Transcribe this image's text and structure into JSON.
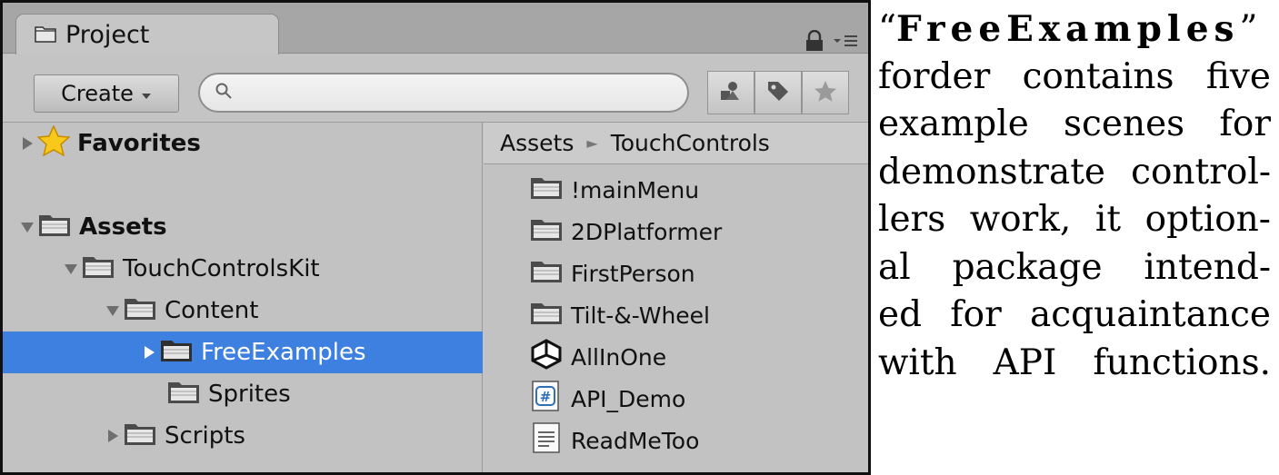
{
  "project_panel": {
    "tab": {
      "label": "Project",
      "icon": "folder-icon"
    },
    "toolbar": {
      "create_label": "Create",
      "search_value": "",
      "search_placeholder": "",
      "buttons": [
        "filter-by-type-icon",
        "filter-by-label-icon",
        "favorites-star-icon"
      ]
    },
    "tree": [
      {
        "label": "Favorites",
        "icon": "star-icon",
        "expanded": false,
        "bold": true
      },
      {
        "label": "Assets",
        "icon": "folder-icon",
        "expanded": true,
        "bold": true
      },
      {
        "label": "TouchControlsKit",
        "icon": "folder-icon",
        "expanded": true
      },
      {
        "label": "Content",
        "icon": "folder-icon",
        "expanded": true
      },
      {
        "label": "FreeExamples",
        "icon": "folder-icon",
        "expanded": false,
        "selected": true
      },
      {
        "label": "Sprites",
        "icon": "folder-icon"
      },
      {
        "label": "Scripts",
        "icon": "folder-icon",
        "expanded": false
      }
    ],
    "breadcrumb": [
      "Assets",
      "TouchControls"
    ],
    "items": [
      {
        "label": "!mainMenu",
        "icon": "folder-icon"
      },
      {
        "label": "2DPlatformer",
        "icon": "folder-icon"
      },
      {
        "label": "FirstPerson",
        "icon": "folder-icon"
      },
      {
        "label": "Tilt-&-Wheel",
        "icon": "folder-icon"
      },
      {
        "label": "AllInOne",
        "icon": "unity-scene-icon"
      },
      {
        "label": "API_Demo",
        "icon": "csharp-script-icon"
      },
      {
        "label": "ReadMeToo",
        "icon": "text-file-icon"
      }
    ]
  },
  "description": {
    "lines": [
      [
        "“",
        "FreeExamples",
        "”"
      ],
      [
        "forder",
        "contains",
        "five"
      ],
      [
        "example",
        "scenes",
        "for"
      ],
      [
        "demonstrate",
        "control-"
      ],
      [
        "lers",
        "work,",
        "it",
        "option-"
      ],
      [
        "al",
        "package",
        "intend-"
      ],
      [
        "ed",
        "for",
        "acquaintance"
      ],
      [
        "with",
        "API",
        "functions."
      ]
    ]
  },
  "colors": {
    "panel_bg": "#c2c2c2",
    "tab_bar_bg": "#a6a6a6",
    "selection": "#3d80df",
    "border": "#101010"
  }
}
